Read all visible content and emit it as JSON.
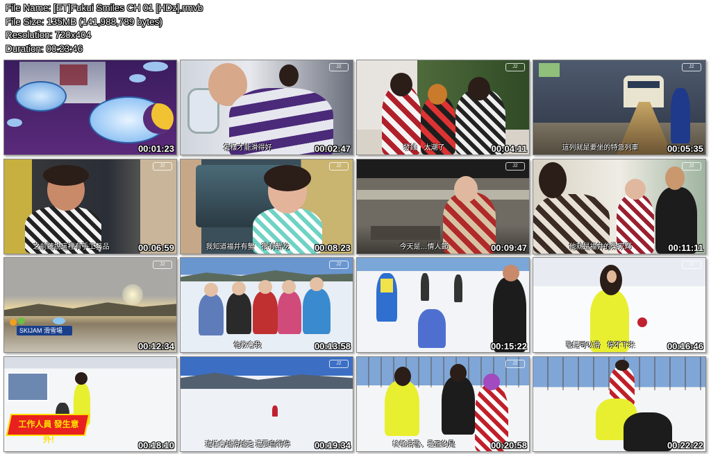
{
  "meta": {
    "file_name": "File Name: [ET]Fukui Smiles CH 01 [HDz].rmvb",
    "file_size": "File Size: 135MB (141,988,789 bytes)",
    "resolution": "Resolution: 720x404",
    "duration": "Duration: 00:23:46"
  },
  "thumbnails": [
    {
      "time": "00:01:23",
      "subtitle": ""
    },
    {
      "time": "00:02:47",
      "subtitle": "怎樣才能滑得好"
    },
    {
      "time": "00:04:11",
      "subtitle": "發錢　太潮了"
    },
    {
      "time": "00:05:35",
      "subtitle": "這列就是要坐的特急列車"
    },
    {
      "time": "00:06:59",
      "subtitle": "之前聽說這裡有手工藝品"
    },
    {
      "time": "00:08:23",
      "subtitle": "我知道福井有蟹　很有蟹吃"
    },
    {
      "time": "00:09:47",
      "subtitle": "今天是…情人節"
    },
    {
      "time": "00:11:11",
      "subtitle": "他就是福井的梁家輝"
    },
    {
      "time": "00:12:34",
      "subtitle": "SKIJAM 滑雪場"
    },
    {
      "time": "00:13:58",
      "subtitle": "他教會我"
    },
    {
      "time": "00:15:22",
      "subtitle": ""
    },
    {
      "time": "00:16:46",
      "subtitle": "已經可以滑　停不下來"
    },
    {
      "time": "00:18:10",
      "subtitle": "工作人員 發生意外!"
    },
    {
      "time": "00:19:34",
      "subtitle": "這樣會越滑越遠 還要自行停"
    },
    {
      "time": "00:20:58",
      "subtitle": "終極滑雪，最正的是"
    },
    {
      "time": "00:22:22",
      "subtitle": ""
    }
  ],
  "logo_text": "J2",
  "skijam_label": "SKIJAM 滑雪場",
  "banner_text": "工作人員 發生意外!"
}
